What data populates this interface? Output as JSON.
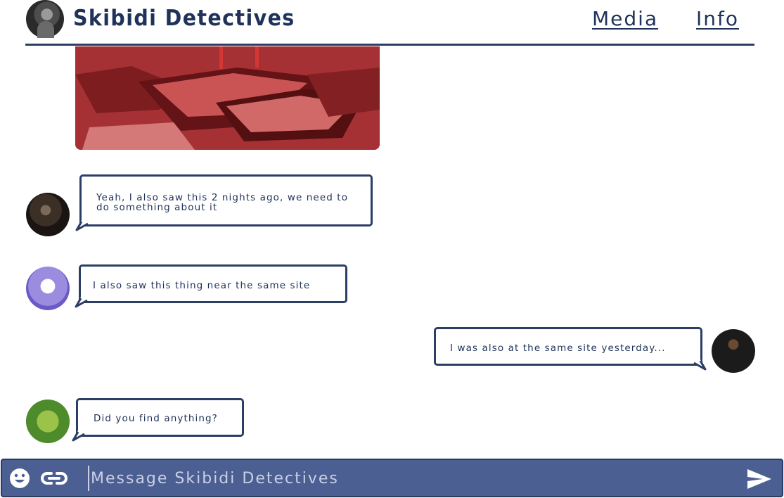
{
  "header": {
    "title": "Skibidi Detectives",
    "nav": [
      {
        "label": "Media"
      },
      {
        "label": "Info"
      }
    ]
  },
  "messages": [
    {
      "text": "Yeah, I also saw this 2 nights ago, we need to do something about it",
      "side": "left",
      "avatar": "hooded-man-avatar"
    },
    {
      "text": "I also saw this thing near the same site",
      "side": "left",
      "avatar": "snowman-avatar"
    },
    {
      "text": "I was also at the same site yesterday...",
      "side": "right",
      "avatar": "user-avatar"
    },
    {
      "text": "Did you find anything?",
      "side": "left",
      "avatar": "ogre-avatar"
    }
  ],
  "composer": {
    "placeholder": "Message Skibidi Detectives",
    "icons": [
      "emoji-icon",
      "link-icon",
      "send-icon"
    ]
  },
  "colors": {
    "primary": "#1f3259",
    "border": "#2c3e66",
    "composer_bg": "#4c5f92",
    "placeholder": "#c9d0e6"
  }
}
